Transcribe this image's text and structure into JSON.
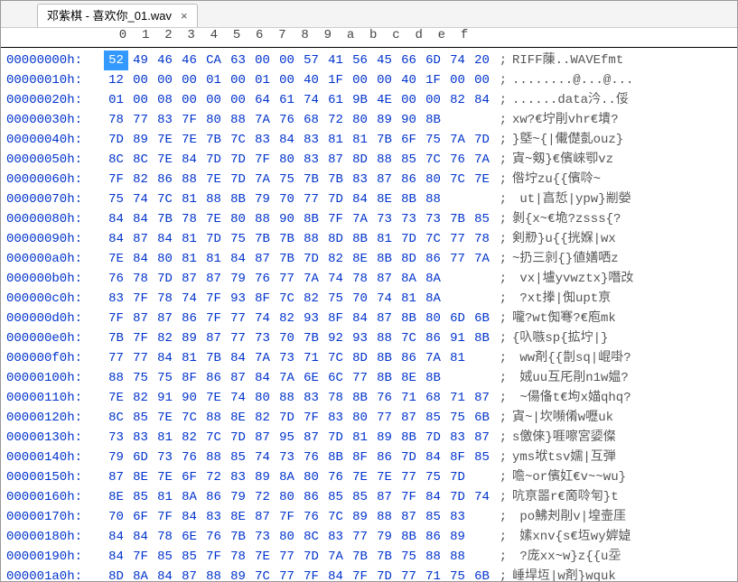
{
  "tab": {
    "title": "邓紫棋 - 喜欢你_01.wav",
    "close_label": "×"
  },
  "hex_columns_header": "  0  1  2  3  4  5  6  7  8  9  a  b  c  d  e  f",
  "selected": {
    "row": 0,
    "col": 0
  },
  "rows": [
    {
      "offset": "00000000h:",
      "hex": [
        "52",
        "49",
        "46",
        "46",
        "CA",
        "63",
        "00",
        "00",
        "57",
        "41",
        "56",
        "45",
        "66",
        "6D",
        "74",
        "20"
      ],
      "ascii": "RIFF蔯..WAVEfmt "
    },
    {
      "offset": "00000010h:",
      "hex": [
        "12",
        "00",
        "00",
        "00",
        "01",
        "00",
        "01",
        "00",
        "40",
        "1F",
        "00",
        "00",
        "40",
        "1F",
        "00",
        "00"
      ],
      "ascii": "........@...@..."
    },
    {
      "offset": "00000020h:",
      "hex": [
        "01",
        "00",
        "08",
        "00",
        "00",
        "00",
        "64",
        "61",
        "74",
        "61",
        "9B",
        "4E",
        "00",
        "00",
        "82",
        "84"
      ],
      "ascii": "......data汵..俀"
    },
    {
      "offset": "00000030h:",
      "hex": [
        "78",
        "77",
        "83",
        "7F",
        "80",
        "88",
        "7A",
        "76",
        "68",
        "72",
        "80",
        "89",
        "90",
        "8B"
      ],
      "ascii": "xw?€坾剈vhr€墤?"
    },
    {
      "offset": "00000040h:",
      "hex": [
        "7D",
        "89",
        "7E",
        "7E",
        "7B",
        "7C",
        "83",
        "84",
        "83",
        "81",
        "81",
        "7B",
        "6F",
        "75",
        "7A",
        "7D"
      ],
      "ascii": "}墍~{|儎儊亄ouz}"
    },
    {
      "offset": "00000050h:",
      "hex": [
        "8C",
        "8C",
        "7E",
        "84",
        "7D",
        "7D",
        "7F",
        "80",
        "83",
        "87",
        "8D",
        "88",
        "85",
        "7C",
        "76",
        "7A"
      ],
      "ascii": "寊~剱}€儐崍卾vz"
    },
    {
      "offset": "00000060h:",
      "hex": [
        "7F",
        "82",
        "86",
        "88",
        "7E",
        "7D",
        "7A",
        "75",
        "7B",
        "7B",
        "83",
        "87",
        "86",
        "80",
        "7C",
        "7E"
      ],
      "ascii": "倃坾zu{{儐唥~"
    },
    {
      "offset": "00000070h:",
      "hex": [
        "75",
        "74",
        "7C",
        "81",
        "88",
        "8B",
        "79",
        "70",
        "77",
        "7D",
        "84",
        "8E",
        "8B",
        "88"
      ],
      "ascii": " ut|亯悊|ypw}剬嫈"
    },
    {
      "offset": "00000080h:",
      "hex": [
        "84",
        "84",
        "7B",
        "78",
        "7E",
        "80",
        "88",
        "90",
        "8B",
        "7F",
        "7A",
        "73",
        "73",
        "73",
        "7B",
        "85"
      ],
      "ascii": "剝{x~€垝?zsss{?"
    },
    {
      "offset": "00000090h:",
      "hex": [
        "84",
        "87",
        "84",
        "81",
        "7D",
        "75",
        "7B",
        "7B",
        "88",
        "8D",
        "8B",
        "81",
        "7D",
        "7C",
        "77",
        "78"
      ],
      "ascii": "剣剙}u{{挄媬|wx"
    },
    {
      "offset": "000000a0h:",
      "hex": [
        "7E",
        "84",
        "80",
        "81",
        "81",
        "84",
        "87",
        "7B",
        "7D",
        "82",
        "8E",
        "8B",
        "8D",
        "86",
        "77",
        "7A"
      ],
      "ascii": "~扔三剠{}値嫸哂z"
    },
    {
      "offset": "000000b0h:",
      "hex": [
        "76",
        "78",
        "7D",
        "87",
        "87",
        "79",
        "76",
        "77",
        "7A",
        "74",
        "78",
        "87",
        "8A",
        "8A"
      ],
      "ascii": " vx|壚yvwztx}噆妀"
    },
    {
      "offset": "000000c0h:",
      "hex": [
        "83",
        "7F",
        "78",
        "74",
        "7F",
        "93",
        "8F",
        "7C",
        "82",
        "75",
        "70",
        "74",
        "81",
        "8A"
      ],
      "ascii": " ?xt搼|倁upt亰"
    },
    {
      "offset": "000000d0h:",
      "hex": [
        "7F",
        "87",
        "87",
        "86",
        "7F",
        "77",
        "74",
        "82",
        "93",
        "8F",
        "84",
        "87",
        "8B",
        "80",
        "6D",
        "6B"
      ],
      "ascii": "嚨?wt倁弿?€庖mk"
    },
    {
      "offset": "000000e0h:",
      "hex": [
        "7B",
        "7F",
        "82",
        "89",
        "87",
        "77",
        "73",
        "70",
        "7B",
        "92",
        "93",
        "88",
        "7C",
        "86",
        "91",
        "8B"
      ],
      "ascii": "{叺嗾sp{拡坾|}"
    },
    {
      "offset": "000000f0h:",
      "hex": [
        "77",
        "77",
        "84",
        "81",
        "7B",
        "84",
        "7A",
        "73",
        "71",
        "7C",
        "8D",
        "8B",
        "86",
        "7A",
        "81"
      ],
      "ascii": " ww剤{{剒sq|崐啩?"
    },
    {
      "offset": "00000100h:",
      "hex": [
        "88",
        "75",
        "75",
        "8F",
        "86",
        "87",
        "84",
        "7A",
        "6E",
        "6C",
        "77",
        "8B",
        "8E",
        "8B"
      ],
      "ascii": " 娀uu互厇剈n1w媪?"
    },
    {
      "offset": "00000110h:",
      "hex": [
        "7E",
        "82",
        "91",
        "90",
        "7E",
        "74",
        "80",
        "88",
        "83",
        "78",
        "8B",
        "76",
        "71",
        "68",
        "71",
        "87"
      ],
      "ascii": " ~偒俻t€坸x媌qhq?"
    },
    {
      "offset": "00000120h:",
      "hex": [
        "8C",
        "85",
        "7E",
        "7C",
        "88",
        "8E",
        "82",
        "7D",
        "7F",
        "83",
        "80",
        "77",
        "87",
        "85",
        "75",
        "6B"
      ],
      "ascii": "寊~|坎嚬倄w嚦uk"
    },
    {
      "offset": "00000130h:",
      "hex": [
        "73",
        "83",
        "81",
        "82",
        "7C",
        "7D",
        "87",
        "95",
        "87",
        "7D",
        "81",
        "89",
        "8B",
        "7D",
        "83",
        "87"
      ],
      "ascii": "s儌倈}啀嚓宮媭儏"
    },
    {
      "offset": "00000140h:",
      "hex": [
        "79",
        "6D",
        "73",
        "76",
        "88",
        "85",
        "74",
        "73",
        "76",
        "8B",
        "8F",
        "86",
        "7D",
        "84",
        "8F",
        "85"
      ],
      "ascii": "yms垘tsv嬬|互弾"
    },
    {
      "offset": "00000150h:",
      "hex": [
        "87",
        "8E",
        "7E",
        "6F",
        "72",
        "83",
        "89",
        "8A",
        "80",
        "76",
        "7E",
        "7E",
        "77",
        "75",
        "7D"
      ],
      "ascii": "噡~or儐妅€v~~wu}"
    },
    {
      "offset": "00000160h:",
      "hex": [
        "8E",
        "85",
        "81",
        "8A",
        "86",
        "79",
        "72",
        "80",
        "86",
        "85",
        "85",
        "87",
        "7F",
        "84",
        "7D",
        "74"
      ],
      "ascii": "吭亰噐r€啇唥匉}t"
    },
    {
      "offset": "00000170h:",
      "hex": [
        "70",
        "6F",
        "7F",
        "84",
        "83",
        "8E",
        "87",
        "7F",
        "76",
        "7C",
        "89",
        "88",
        "87",
        "85",
        "83"
      ],
      "ascii": " po鮄刔剈v|堭壸厓"
    },
    {
      "offset": "00000180h:",
      "hex": [
        "84",
        "84",
        "78",
        "6E",
        "76",
        "7B",
        "73",
        "80",
        "8C",
        "83",
        "77",
        "79",
        "8B",
        "86",
        "89"
      ],
      "ascii": " 嫊xnv{s€坘wy婩媫"
    },
    {
      "offset": "00000190h:",
      "hex": [
        "84",
        "7F",
        "85",
        "85",
        "7F",
        "78",
        "7E",
        "77",
        "7D",
        "7A",
        "7B",
        "7B",
        "75",
        "88",
        "88"
      ],
      "ascii": " ?庞xx~w}z{{u坖"
    },
    {
      "offset": "000001a0h:",
      "hex": [
        "8D",
        "8A",
        "84",
        "87",
        "88",
        "89",
        "7C",
        "77",
        "7F",
        "84",
        "7F",
        "7D",
        "77",
        "71",
        "75",
        "6B"
      ],
      "ascii": "崜垾坘|w剤}wquk"
    }
  ]
}
